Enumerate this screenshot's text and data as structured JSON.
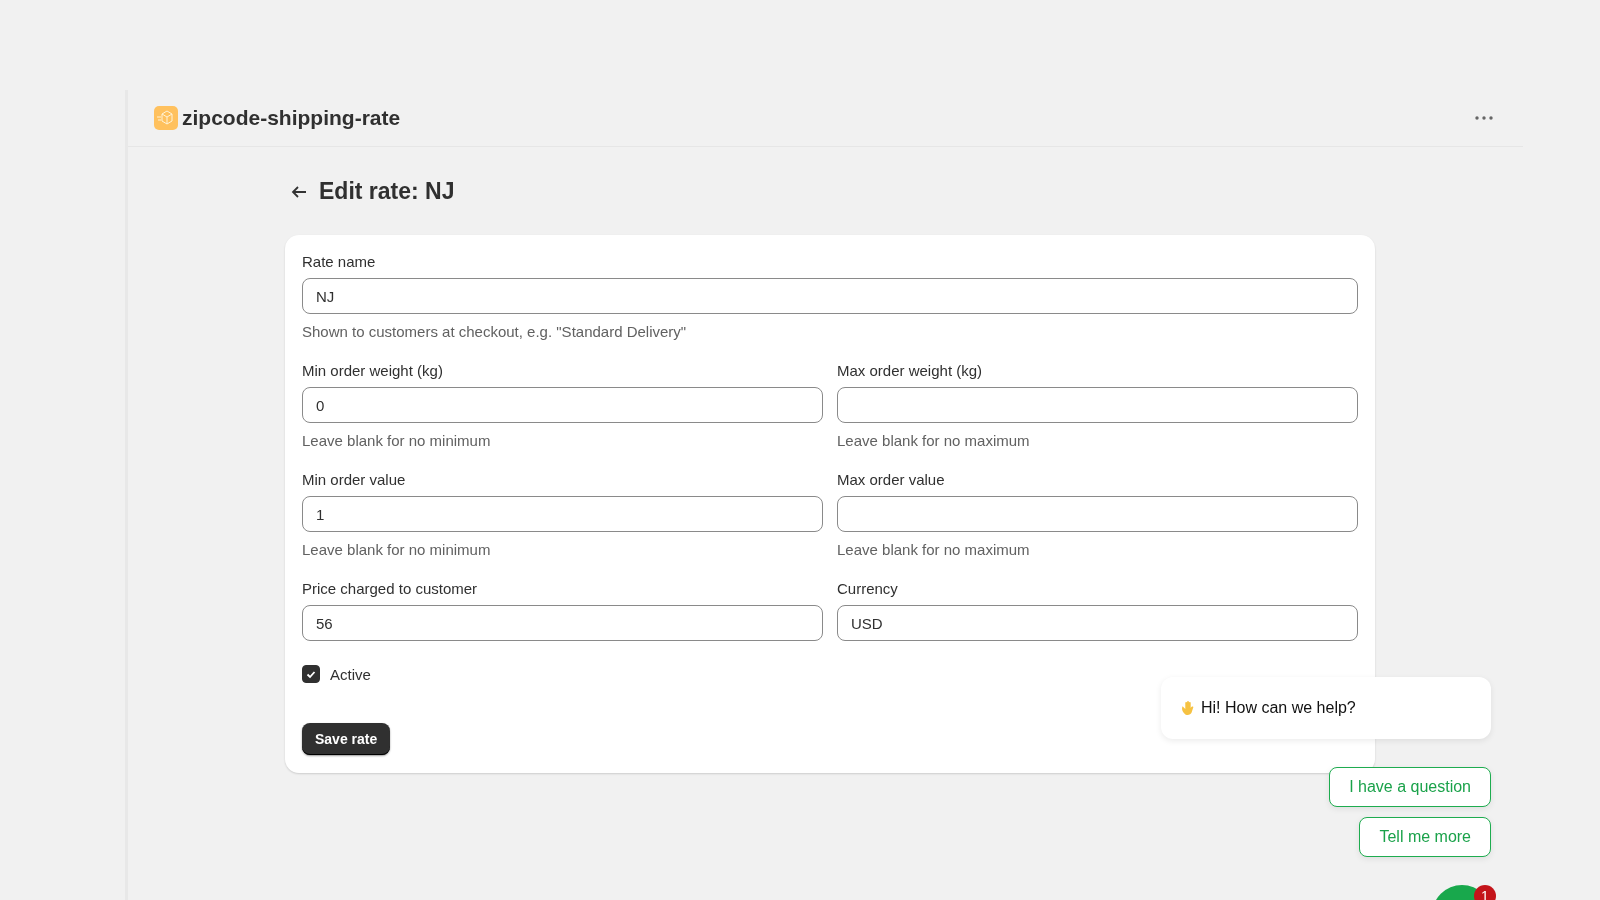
{
  "app": {
    "title": "zipcode-shipping-rate"
  },
  "page": {
    "title": "Edit rate: NJ"
  },
  "form": {
    "rate_name": {
      "label": "Rate name",
      "value": "NJ",
      "help": "Shown to customers at checkout, e.g. \"Standard Delivery\""
    },
    "fields": [
      {
        "label": "Min order weight (kg)",
        "value": "0",
        "help": "Leave blank for no minimum"
      },
      {
        "label": "Max order weight (kg)",
        "help": "Leave blank for no maximum"
      },
      {
        "label": "Min order value",
        "value": "1",
        "help": "Leave blank for no minimum"
      },
      {
        "label": "Max order value",
        "help": "Leave blank for no maximum"
      },
      {
        "label": "Price charged to customer",
        "value": "56"
      },
      {
        "label": "Currency",
        "value": "USD"
      }
    ],
    "active": {
      "label": "Active",
      "checked": true
    },
    "save_button": "Save rate"
  },
  "chat": {
    "message": "Hi! How can we help?",
    "replies": [
      "I have a question",
      "Tell me more"
    ],
    "badge": "1"
  }
}
